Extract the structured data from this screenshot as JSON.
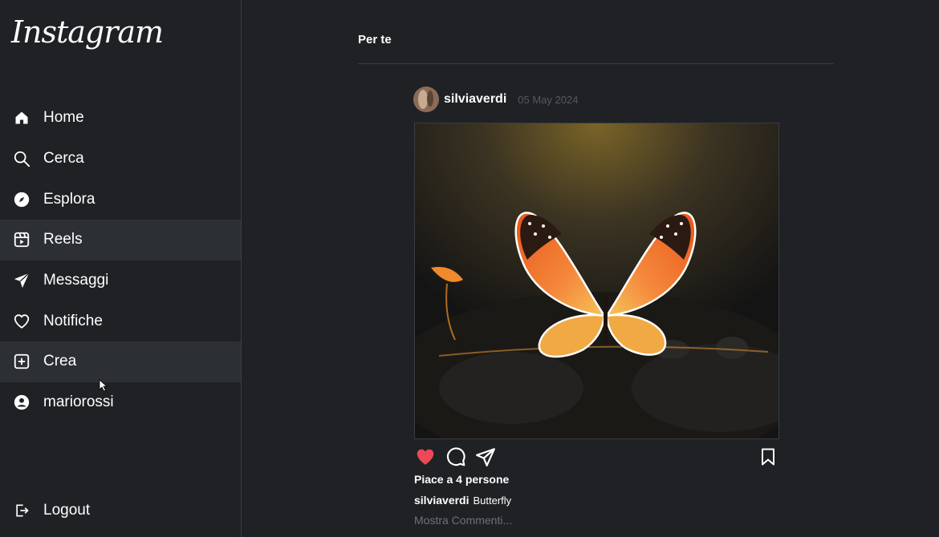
{
  "app": {
    "logo_text": "Instagram"
  },
  "sidebar": {
    "items": [
      {
        "label": "Home",
        "icon": "home-icon"
      },
      {
        "label": "Cerca",
        "icon": "search-icon"
      },
      {
        "label": "Esplora",
        "icon": "compass-icon"
      },
      {
        "label": "Reels",
        "icon": "reels-icon"
      },
      {
        "label": "Messaggi",
        "icon": "send-icon"
      },
      {
        "label": "Notifiche",
        "icon": "heart-icon"
      },
      {
        "label": "Crea",
        "icon": "plus-square-icon"
      },
      {
        "label": "mariorossi",
        "icon": "user-icon"
      }
    ],
    "logout_label": "Logout"
  },
  "feed": {
    "tab_label": "Per te"
  },
  "post": {
    "username": "silviaverdi",
    "date": "05 May 2024",
    "likes_text": "Piace a 4 persone",
    "caption_user": "silviaverdi",
    "caption_text": "Butterfly",
    "comments_link": "Mostra Commenti...",
    "liked": true
  },
  "colors": {
    "background": "#1f2125",
    "hover": "#2c2f33",
    "like": "#ed4956",
    "muted": "#6e7176"
  }
}
